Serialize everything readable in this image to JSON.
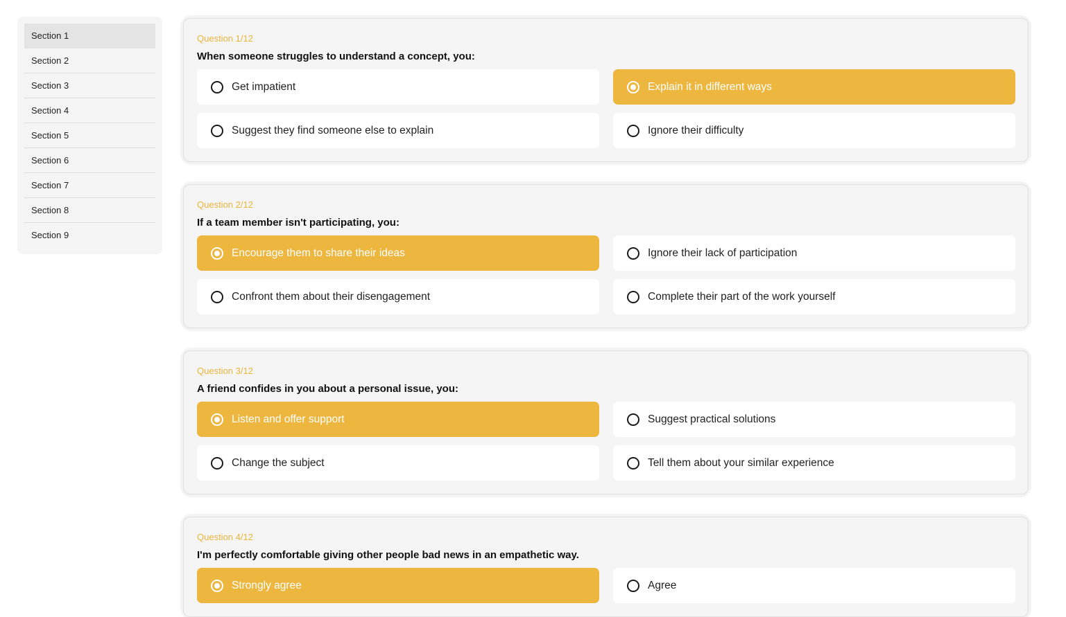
{
  "sidebar": {
    "items": [
      {
        "label": "Section 1"
      },
      {
        "label": "Section 2"
      },
      {
        "label": "Section 3"
      },
      {
        "label": "Section 4"
      },
      {
        "label": "Section 5"
      },
      {
        "label": "Section 6"
      },
      {
        "label": "Section 7"
      },
      {
        "label": "Section 8"
      },
      {
        "label": "Section 9"
      }
    ],
    "active_index": 0
  },
  "colors": {
    "accent": "#ecb63f",
    "counter": "#e8b43a",
    "card_bg": "#f5f5f5"
  },
  "questions": [
    {
      "counter": "Question 1/12",
      "text": "When someone struggles to understand a concept, you:",
      "options": [
        {
          "label": "Get impatient"
        },
        {
          "label": "Explain it in different ways"
        },
        {
          "label": "Suggest they find someone else to explain"
        },
        {
          "label": "Ignore their difficulty"
        }
      ],
      "selected_index": 1
    },
    {
      "counter": "Question 2/12",
      "text": "If a team member isn't participating, you:",
      "options": [
        {
          "label": "Encourage them to share their ideas"
        },
        {
          "label": "Ignore their lack of participation"
        },
        {
          "label": "Confront them about their disengagement"
        },
        {
          "label": "Complete their part of the work yourself"
        }
      ],
      "selected_index": 0
    },
    {
      "counter": "Question 3/12",
      "text": "A friend confides in you about a personal issue, you:",
      "options": [
        {
          "label": "Listen and offer support"
        },
        {
          "label": "Suggest practical solutions"
        },
        {
          "label": "Change the subject"
        },
        {
          "label": "Tell them about your similar experience"
        }
      ],
      "selected_index": 0
    },
    {
      "counter": "Question 4/12",
      "text": "I'm perfectly comfortable giving other people bad news in an empathetic way.",
      "options": [
        {
          "label": "Strongly agree"
        },
        {
          "label": "Agree"
        }
      ],
      "selected_index": 0
    }
  ]
}
